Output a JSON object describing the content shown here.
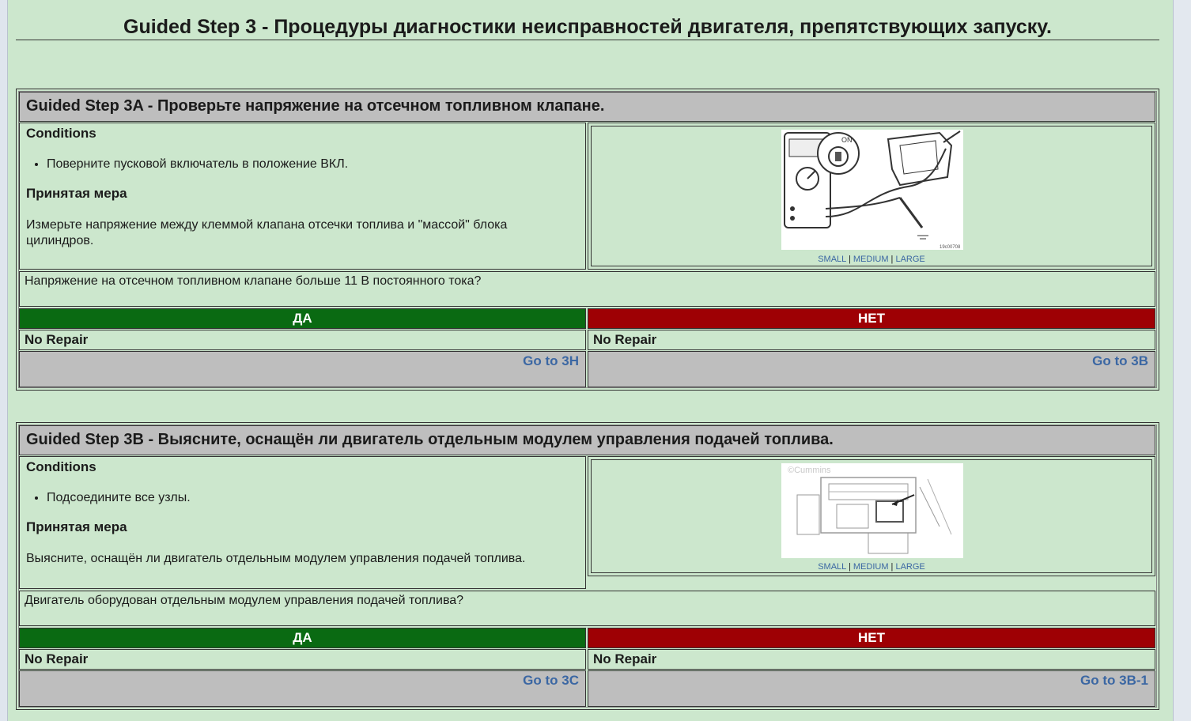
{
  "page": {
    "title": "Guided Step 3 - Процедуры диагностики неисправностей двигателя, препятствующих запуску."
  },
  "steps": [
    {
      "heading": "Guided Step 3A - Проверьте напряжение на отсечном топливном клапане.",
      "conditions_label": "Conditions",
      "condition_item": "Поверните пусковой включатель в положение ВКЛ.",
      "action_label": "Принятая мера",
      "action_text": "Измерьте напряжение между клеммой клапана отсечки топлива и \"массой\" блока цилиндров.",
      "image_links": {
        "small": "SMALL",
        "medium": "MEDIUM",
        "large": "LARGE",
        "sep": "|"
      },
      "image_caption": "19c00708",
      "question": "Напряжение на отсечном топливном клапане больше 11 В постоянного тока?",
      "yes_label": "ДА",
      "no_label": "НЕТ",
      "yes_result": "No Repair",
      "no_result": "No Repair",
      "yes_goto": "Go to 3H",
      "no_goto": "Go to 3B"
    },
    {
      "heading": "Guided Step 3B - Выясните, оснащён ли двигатель отдельным модулем управления подачей топлива.",
      "conditions_label": "Conditions",
      "condition_item": "Подсоедините все узлы.",
      "action_label": "Принятая мера",
      "action_text": "Выясните, оснащён ли двигатель отдельным модулем управления подачей топлива.",
      "image_links": {
        "small": "SMALL",
        "medium": "MEDIUM",
        "large": "LARGE",
        "sep": "|"
      },
      "image_watermark": "©Cummins",
      "question": "Двигатель оборудован отдельным модулем управления подачей топлива?",
      "yes_label": "ДА",
      "no_label": "НЕТ",
      "yes_result": "No Repair",
      "no_result": "No Repair",
      "yes_goto": "Go to 3C",
      "no_goto": "Go to 3B-1"
    }
  ],
  "colors": {
    "background": "#cce7cd",
    "header_gray": "#bebebe",
    "yes_green": "#0a6a12",
    "no_red": "#9e0004",
    "link_blue": "#3b67a3"
  }
}
